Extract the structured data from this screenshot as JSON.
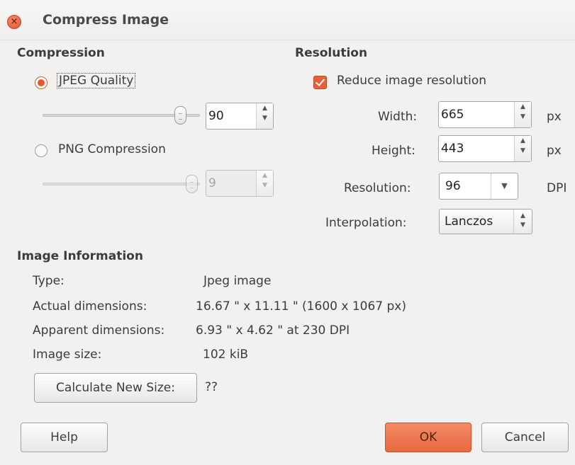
{
  "window": {
    "title": "Compress Image",
    "close_icon": "close-icon"
  },
  "compression": {
    "header": "Compression",
    "jpeg": {
      "label": "JPEG Quality",
      "selected": true,
      "value": "90",
      "slider_fraction": 0.9
    },
    "png": {
      "label": "PNG Compression",
      "selected": false,
      "value": "9",
      "slider_fraction": 1.0
    }
  },
  "resolution": {
    "header": "Resolution",
    "reduce_label": "Reduce image resolution",
    "reduce_checked": true,
    "width": {
      "label": "Width:",
      "value": "665",
      "unit": "px"
    },
    "height": {
      "label": "Height:",
      "value": "443",
      "unit": "px"
    },
    "resolution": {
      "label": "Resolution:",
      "value": "96",
      "unit": "DPI"
    },
    "interpolation": {
      "label": "Interpolation:",
      "value": "Lanczos"
    }
  },
  "image_info": {
    "header": "Image Information",
    "type_label": "Type:",
    "type_value": "Jpeg image",
    "actual_label": "Actual dimensions:",
    "actual_value": "16.67 \" x 11.11 \" (1600 x 1067 px)",
    "apparent_label": "Apparent dimensions:",
    "apparent_value": "6.93 \" x 4.62 \" at 230 DPI",
    "size_label": "Image size:",
    "size_value": "102 kiB",
    "calc_button": "Calculate New Size:",
    "calc_result": "??"
  },
  "buttons": {
    "help": "Help",
    "ok": "OK",
    "cancel": "Cancel"
  },
  "colors": {
    "accent": "#e8603a",
    "background": "#f2f1f0"
  }
}
